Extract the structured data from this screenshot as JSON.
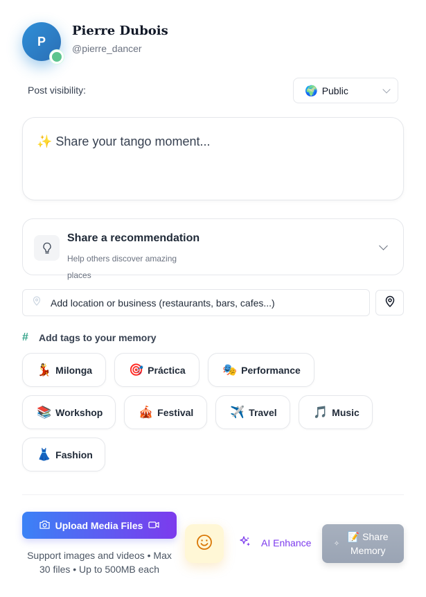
{
  "user": {
    "avatar_initial": "P",
    "name": "Pierre Dubois",
    "handle": "@pierre_dancer"
  },
  "visibility": {
    "label": "Post visibility:",
    "selected": "Public",
    "icon": "🌍"
  },
  "composer": {
    "placeholder": "✨ Share your tango moment..."
  },
  "recommendation": {
    "title": "Share a recommendation",
    "subtitle": "Help others discover amazing places"
  },
  "location": {
    "placeholder": "Add location or business (restaurants, bars, cafes...)"
  },
  "tags": {
    "heading": "Add tags to your memory",
    "items": [
      {
        "emoji": "💃",
        "label": "Milonga"
      },
      {
        "emoji": "🎯",
        "label": "Práctica"
      },
      {
        "emoji": "🎭",
        "label": "Performance"
      },
      {
        "emoji": "📚",
        "label": "Workshop"
      },
      {
        "emoji": "🎪",
        "label": "Festival"
      },
      {
        "emoji": "✈️",
        "label": "Travel"
      },
      {
        "emoji": "🎵",
        "label": "Music"
      },
      {
        "emoji": "👗",
        "label": "Fashion"
      }
    ]
  },
  "footer": {
    "upload_label": "Upload Media Files",
    "upload_note": "Support images and videos • Max 30 files • Up to 500MB each",
    "ai_label": "AI Enhance",
    "share_label": "📝 Share Memory"
  },
  "colors": {
    "accent_teal": "#34a389",
    "upload_gradient_start": "#3b82f6",
    "upload_gradient_end": "#7c3aed",
    "ai_purple": "#7c3aed",
    "share_disabled": "#9ca3af"
  },
  "icons": [
    "avatar",
    "online-status-icon",
    "globe-icon",
    "chevron-down-icon",
    "lightbulb-icon",
    "location-pin-icon",
    "map-pin-icon",
    "hash-icon",
    "camera-icon",
    "video-icon",
    "smiley-icon",
    "sparkles-icon"
  ]
}
